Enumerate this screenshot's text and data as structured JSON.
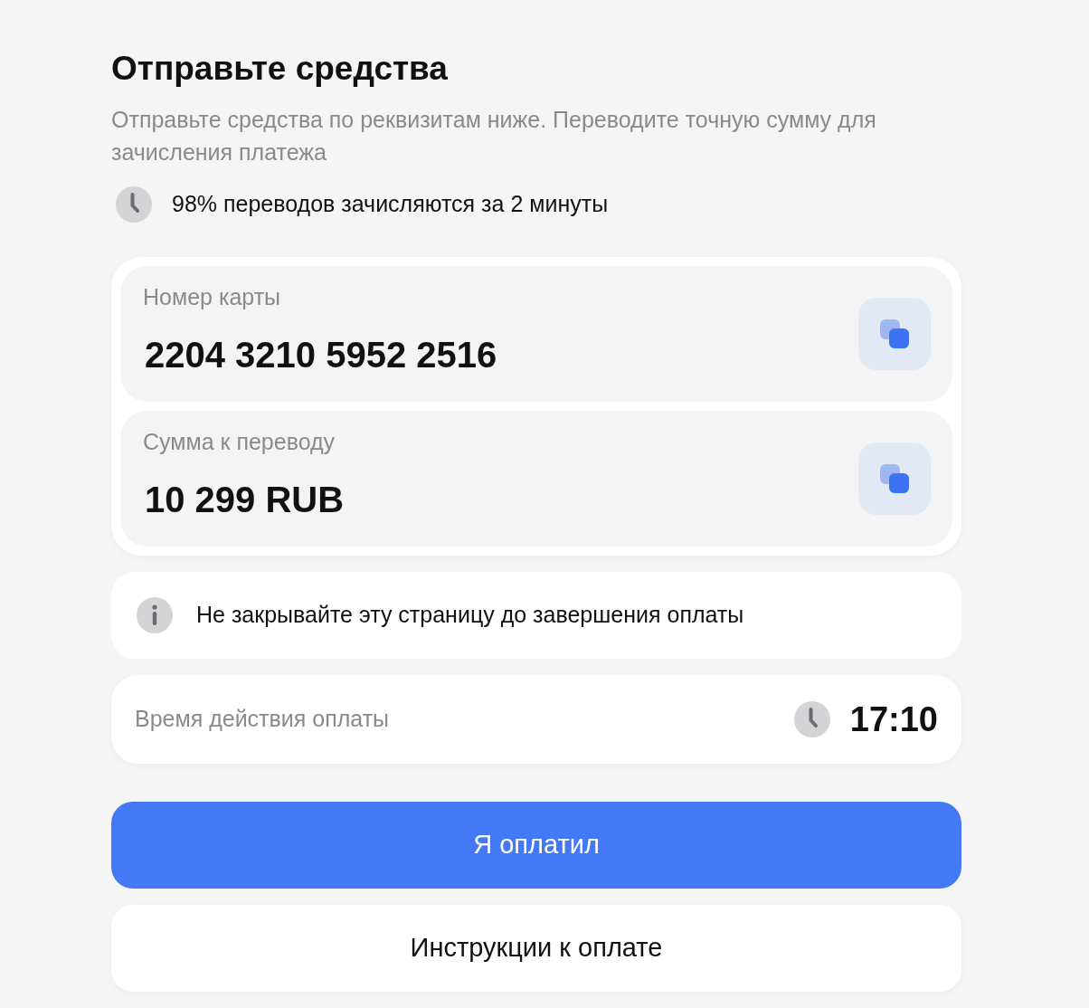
{
  "title": "Отправьте средства",
  "subtitle": "Отправьте средства по реквизитам ниже. Переводите точную сумму для зачисления платежа",
  "speed_note": "98% переводов зачисляются за 2 минуты",
  "details": [
    {
      "label": "Номер карты",
      "value": "2204 3210 5952 2516"
    },
    {
      "label": "Сумма к переводу",
      "value": "10 299 RUB"
    }
  ],
  "warning": "Не закрывайте эту страницу до завершения оплаты",
  "timer": {
    "label": "Время действия оплаты",
    "value": "17:10"
  },
  "buttons": [
    {
      "label": "Я оплатил",
      "kind": "primary"
    },
    {
      "label": "Инструкции к оплате",
      "kind": "secondary"
    }
  ]
}
